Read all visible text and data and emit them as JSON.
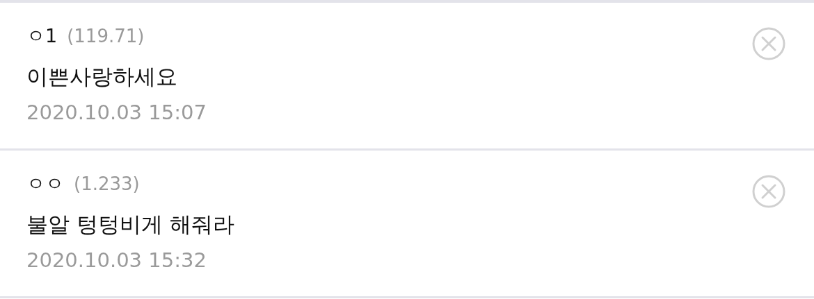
{
  "comments": [
    {
      "author": "ㅇ1",
      "score": "(119.71)",
      "text": "이쁜사랑하세요",
      "date": "2020.10.03 15:07"
    },
    {
      "author": "ㅇㅇ",
      "score": "(1.233)",
      "text": "불알 텅텅비게 해줘라",
      "date": "2020.10.03 15:32"
    }
  ]
}
